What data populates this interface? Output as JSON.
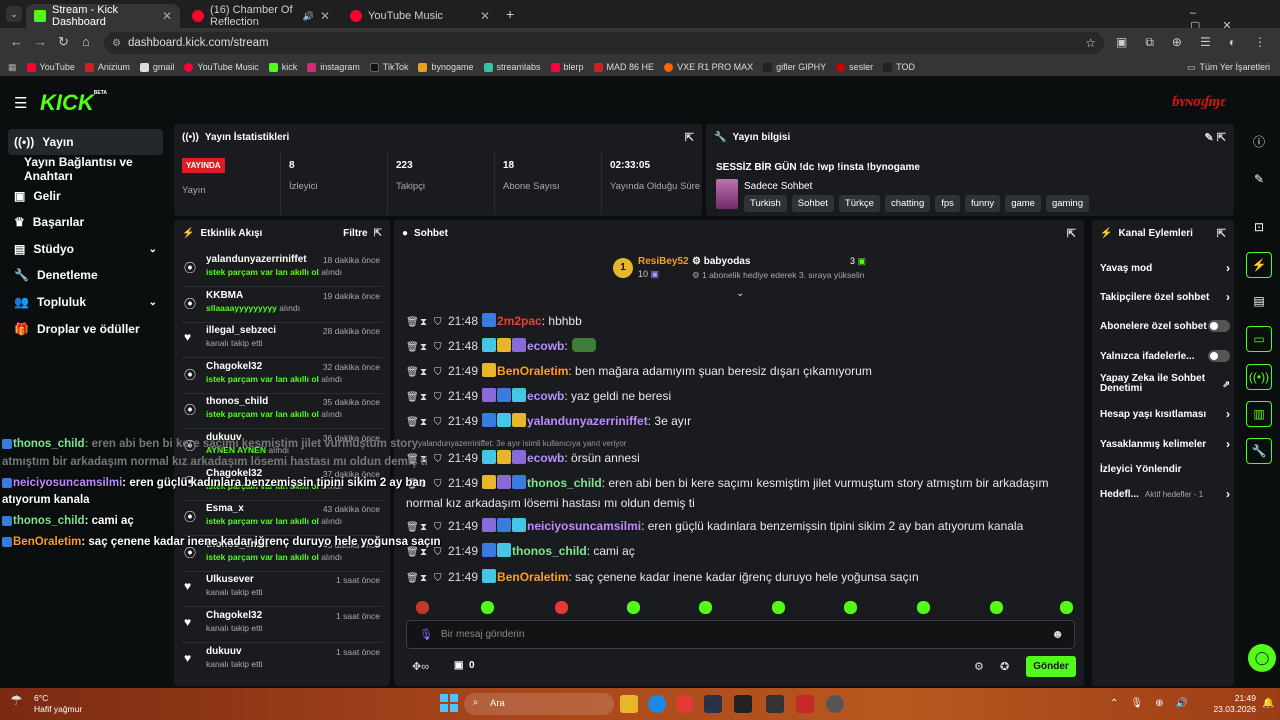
{
  "browser": {
    "tabs": [
      {
        "title": "Stream - Kick Dashboard",
        "color": "#53fc18"
      },
      {
        "title": "(16) Chamber Of Reflection",
        "color": "#ff0033"
      },
      {
        "title": "YouTube Music",
        "color": "#ff0033"
      }
    ],
    "url": "dashboard.kick.com/stream",
    "bookmarks": [
      "YouTube",
      "Anizium",
      "gmail",
      "YouTube Music",
      "kick",
      "instagram",
      "TikTok",
      "bynogame",
      "streamlabs",
      "blerp",
      "MAD 86 HE",
      "VXE R1 PRO MAX",
      "gifler GIPHY",
      "sesler",
      "TOD"
    ],
    "all_bookmarks": "Tüm Yer İşaretleri"
  },
  "kick": {
    "logo": "KICK",
    "logo_beta": "BETA",
    "sidebar": [
      {
        "label": "Yayın",
        "icon": "broadcast-icon"
      },
      {
        "label": "Yayın Bağlantısı ve Anahtarı",
        "icon": ""
      },
      {
        "label": "Gelir",
        "icon": "wallet-icon"
      },
      {
        "label": "Başarılar",
        "icon": "trophy-icon"
      },
      {
        "label": "Stüdyo",
        "icon": "studio-icon"
      },
      {
        "label": "Denetleme",
        "icon": "wrench-icon"
      },
      {
        "label": "Topluluk",
        "icon": "community-icon"
      },
      {
        "label": "Droplar ve ödüller",
        "icon": "gift-icon"
      }
    ],
    "stats": {
      "title": "Yayın İstatistikleri",
      "live_badge": "YAYINDA",
      "live_label": "Yayın",
      "items": [
        {
          "value": "8",
          "label": "İzleyici"
        },
        {
          "value": "223",
          "label": "Takipçi"
        },
        {
          "value": "18",
          "label": "Abone Sayısı"
        },
        {
          "value": "02:33:05",
          "label": "Yayında Olduğu Süre"
        }
      ]
    },
    "info": {
      "title": "Yayın bilgisi",
      "stream_title": "SESSİZ BİR GÜN !dc !wp !insta !bynogame",
      "category": "Sadece Sohbet",
      "tags": [
        "Turkish",
        "Sohbet",
        "Türkçe",
        "chatting",
        "fps",
        "funny",
        "game",
        "gaming"
      ]
    },
    "activity": {
      "title": "Etkinlik Akışı",
      "filter": "Filtre",
      "items": [
        {
          "name": "yalandunyazerriniffet",
          "sub_hl": "istek parçam var lan akıllı ol",
          "sub": " alındı",
          "time": "18 dakika önce",
          "icon": "redeem-icon"
        },
        {
          "name": "KKBMA",
          "sub_hl": "sllaaaayyyyyyyyy",
          "sub": " alındı",
          "time": "19 dakika önce",
          "icon": "redeem-icon"
        },
        {
          "name": "illegal_sebzeci",
          "sub_hl": "",
          "sub": "kanalı takip etti",
          "time": "28 dakika önce",
          "icon": "heart-icon"
        },
        {
          "name": "Chagokel32",
          "sub_hl": "istek parçam var lan akıllı ol",
          "sub": " alındı",
          "time": "32 dakika önce",
          "icon": "redeem-icon"
        },
        {
          "name": "thonos_child",
          "sub_hl": "istek parçam var lan akıllı ol",
          "sub": " alındı",
          "time": "35 dakika önce",
          "icon": "redeem-icon"
        },
        {
          "name": "dukuuv",
          "sub_hl": "AYNEN AYNEN",
          "sub": " alındı",
          "time": "36 dakika önce",
          "icon": "redeem-icon"
        },
        {
          "name": "Chagokel32",
          "sub_hl": "istek parçam var lan akıllı ol",
          "sub": " alındı",
          "time": "37 dakika önce",
          "icon": "redeem-icon"
        },
        {
          "name": "Esma_x",
          "sub_hl": "istek parçam var lan akıllı ol",
          "sub": " alındı",
          "time": "43 dakika önce",
          "icon": "redeem-icon"
        },
        {
          "name": "thonos_child",
          "sub_hl": "istek parçam var lan akıllı ol",
          "sub": " alındı",
          "time": "45 dakika önce",
          "icon": "redeem-icon"
        },
        {
          "name": "Ulkusever",
          "sub_hl": "",
          "sub": "kanalı takip etti",
          "time": "1 saat önce",
          "icon": "heart-icon"
        },
        {
          "name": "Chagokel32",
          "sub_hl": "",
          "sub": "kanalı takip etti",
          "time": "1 saat önce",
          "icon": "heart-icon"
        },
        {
          "name": "dukuuv",
          "sub_hl": "",
          "sub": "kanalı takip etti",
          "time": "1 saat önce",
          "icon": "heart-icon"
        }
      ]
    },
    "chat": {
      "title": "Sohbet",
      "top_gifter": "ResiBey52",
      "top_gifter_count": "10",
      "gift_user": "babyodas",
      "gift_count": "3",
      "gift_note": "1 abonelik hediye ederek 3. sıraya yükselin",
      "reply_note": "yalandunyazerriniffet: 3e ayır isimli kullanıcıya yanıt veriyor",
      "messages": [
        {
          "time": "21:48",
          "user": "2m2pac",
          "color": "#e8403a",
          "text": ": hbhbb"
        },
        {
          "time": "21:48",
          "user": "ecowb",
          "color": "#b592ff",
          "text": ":"
        },
        {
          "time": "21:49",
          "user": "BenOraletim",
          "color": "#ff9d1f",
          "text": ": ben mağara adamıyım şuan beresiz dışarı çıkamıyorum"
        },
        {
          "time": "21:49",
          "user": "ecowb",
          "color": "#b592ff",
          "text": ": yaz geldi ne beresi"
        },
        {
          "time": "21:49",
          "user": "yalandunyazerriniffet",
          "color": "#c08bff",
          "text": ": 3e ayır"
        },
        {
          "time": "21:49",
          "user": "ecowb",
          "color": "#b592ff",
          "text": ": örsün annesi"
        },
        {
          "time": "21:49",
          "user": "thonos_child",
          "color": "#7ee68f",
          "text": ": eren abi ben bi kere saçımı kesmiştim jilet vurmuştum story atmıştım bir arkadaşım normal kız arkadaşım lösemi hastası mı oldun demiş ti"
        },
        {
          "time": "21:49",
          "user": "neiciyosuncamsilmi",
          "color": "#c08bff",
          "text": ": eren güçlü kadınlara benzemişsin tipini sikim 2 ay ban atıyorum kanala"
        },
        {
          "time": "21:49",
          "user": "thonos_child",
          "color": "#7ee68f",
          "text": ": cami aç"
        },
        {
          "time": "21:49",
          "user": "BenOraletim",
          "color": "#ff9d1f",
          "text": ": saç çenene kadar inene kadar iğrenç duruyo hele yoğunsa saçın"
        }
      ],
      "input_placeholder": "Bir mesaj gönderin",
      "points": "0",
      "send": "Gönder"
    },
    "channel_actions": {
      "title": "Kanal Eylemleri",
      "items": [
        {
          "label": "Yavaş mod",
          "kind": "arrow"
        },
        {
          "label": "Takipçilere özel sohbet",
          "kind": "arrow"
        },
        {
          "label": "Abonelere özel sohbet",
          "kind": "toggle"
        },
        {
          "label": "Yalnızca ifadelerle...",
          "kind": "toggle"
        },
        {
          "label": "Yapay Zeka ile Sohbet Denetimi",
          "kind": "ext"
        },
        {
          "label": "Hesap yaşı kısıtlaması",
          "kind": "arrow"
        },
        {
          "label": "Yasaklanmış kelimeler",
          "kind": "arrow"
        },
        {
          "label": "İzleyici Yönlendir",
          "kind": "none"
        },
        {
          "label": "Hedefl...",
          "kind": "arrow",
          "extra": "Aktif hedefler - 1"
        }
      ]
    },
    "overlay": [
      {
        "user": "thonos_child",
        "text": ": eren abi ben bi kere saçımı kesmiştim jilet vurmuştum story"
      },
      {
        "user": "",
        "text": "atmıştım bir arkadaşım normal kız arkadaşım lösemi hastası mı oldun demiş ti"
      },
      {
        "user": "neiciyosuncamsilmi",
        "text": ": eren güçlü kadınlara benzemişsin tipini sikim 2 ay ban"
      },
      {
        "user": "",
        "text": "atıyorum kanala"
      },
      {
        "user": "thonos_child",
        "text": ": cami aç"
      },
      {
        "user": "BenOraletim",
        "text": ": saç çenene kadar inene kadar iğrenç duruyo hele yoğunsa saçın"
      }
    ]
  },
  "taskbar": {
    "weather_temp": "6°C",
    "weather_desc": "Hafif yağmur",
    "search": "Ara",
    "time": "21:49",
    "date": "23.03.2026"
  }
}
